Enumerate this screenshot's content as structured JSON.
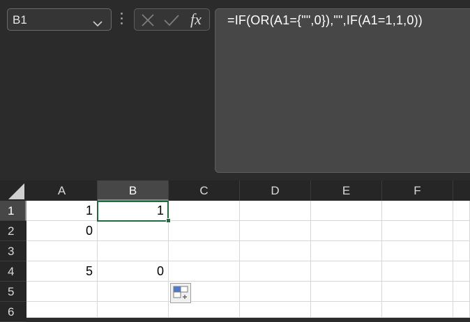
{
  "name_box": {
    "value": "B1"
  },
  "formula_bar": {
    "formula": "=IF(OR(A1={\"\",0}),\"\",IF(A1=1,1,0))",
    "fx_label": "fx"
  },
  "columns": [
    "A",
    "B",
    "C",
    "D",
    "E",
    "F"
  ],
  "rows": [
    "1",
    "2",
    "3",
    "4",
    "5",
    "6"
  ],
  "cells": {
    "A1": "1",
    "B1": "1",
    "A2": "0",
    "B2": "",
    "A3": "",
    "B3": "",
    "A4": "5",
    "B4": "0"
  },
  "active_cell": "B1",
  "colors": {
    "selection": "#1b6e3b",
    "header_active": "#474747"
  },
  "icons": [
    "chevron-down-icon",
    "cancel-icon",
    "enter-icon",
    "fx-icon",
    "quick-analysis-icon"
  ]
}
